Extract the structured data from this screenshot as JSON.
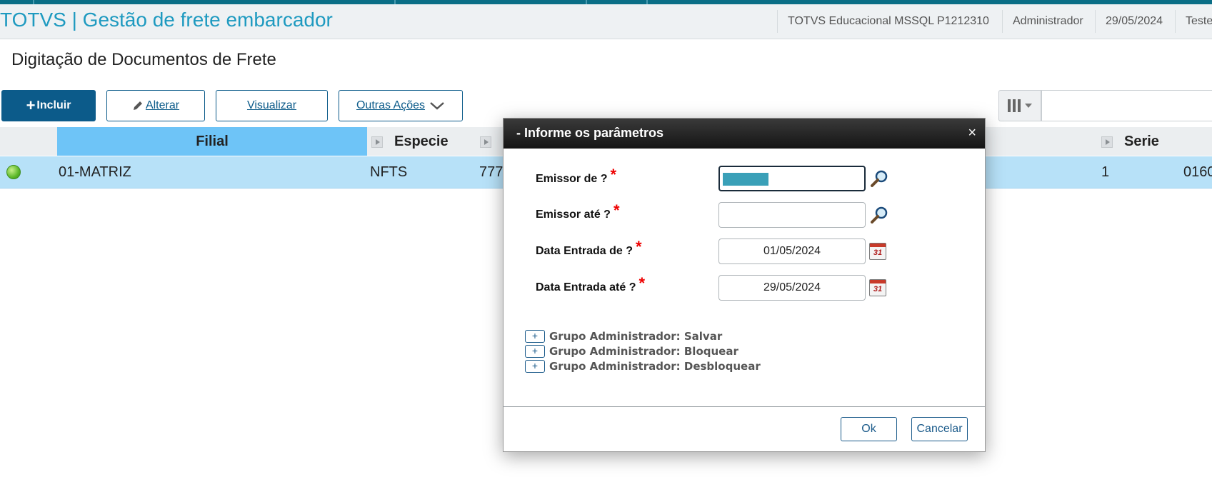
{
  "app": {
    "title": "TOTVS | Gestão de frete embarcador",
    "environment": "TOTVS Educacional MSSQL P1212310",
    "user": "Administrador",
    "date": "29/05/2024",
    "extra": "Teste"
  },
  "page": {
    "title": "Digitação de Documentos de Frete"
  },
  "toolbar": {
    "incluir": "Incluir",
    "alterar": "Alterar",
    "visualizar": "Visualizar",
    "outras_acoes": "Outras Ações"
  },
  "grid": {
    "headers": {
      "filial": "Filial",
      "especie": "Especie",
      "serie": "Serie"
    },
    "row": {
      "filial": "01-MATRIZ",
      "especie": "NFTS",
      "numero": "777",
      "serie": "1",
      "last": "0160"
    }
  },
  "dialog": {
    "title": "- Informe os parâmetros",
    "close": "×",
    "params": [
      {
        "label": "Emissor de ?",
        "value": ""
      },
      {
        "label": "Emissor até ?",
        "value": ""
      },
      {
        "label": "Data Entrada de ?",
        "value": "01/05/2024"
      },
      {
        "label": "Data Entrada até ?",
        "value": "29/05/2024"
      }
    ],
    "required_mark": "*",
    "calendar_glyph": "31",
    "expand_glyph": "+",
    "groups": [
      "Grupo Administrador: Salvar",
      "Grupo Administrador: Bloquear",
      "Grupo Administrador: Desbloquear"
    ],
    "ok": "Ok",
    "cancel": "Cancelar"
  },
  "icons": {
    "search": "magnifier-icon",
    "calendar": "calendar-icon",
    "columns": "columns-icon",
    "pencil": "pencil-icon",
    "plus": "plus-icon",
    "status": "green-status-icon"
  },
  "colors": {
    "brand": "#1e9ac0",
    "primary": "#0c5b8a",
    "selected_header": "#6ec4f7",
    "selected_row": "#b7e1f8",
    "required": "#e00000"
  }
}
